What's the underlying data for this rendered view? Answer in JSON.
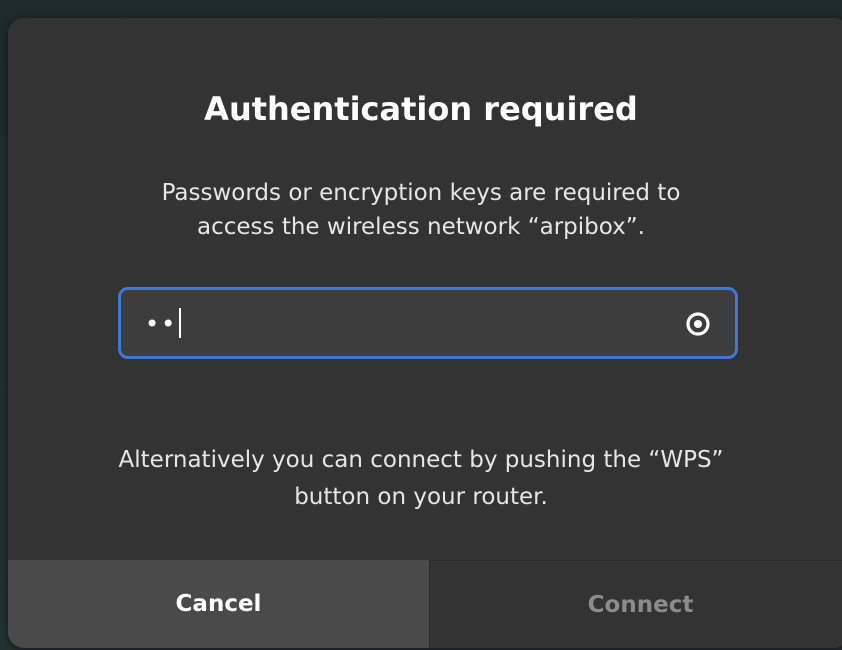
{
  "dialog": {
    "title": "Authentication required",
    "description_line1": "Passwords or encryption keys are required to",
    "description_line2": "access the wireless network “arpibox”.",
    "password_field": {
      "value_masked": "••",
      "icon": "eye-icon"
    },
    "alternative_line1": "Alternatively you can connect by pushing the “WPS”",
    "alternative_line2": "button on your router.",
    "buttons": {
      "cancel_label": "Cancel",
      "connect_label": "Connect"
    }
  },
  "colors": {
    "dialog_bg": "#333333",
    "focus_border": "#3c7ad6",
    "cancel_bg": "#4a4a4a",
    "connect_text_disabled": "#8c8c8c"
  }
}
